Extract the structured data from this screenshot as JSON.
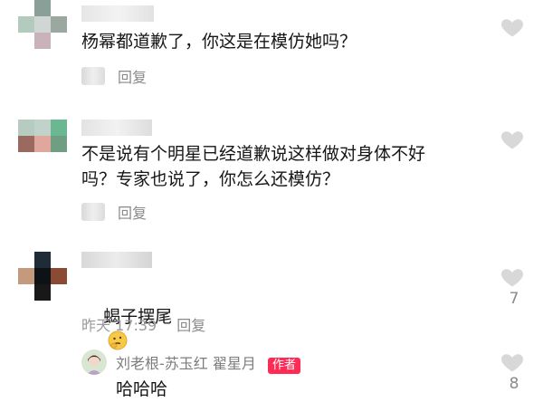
{
  "comments": [
    {
      "text": "杨幂都道歉了，你这是在模仿她吗？",
      "reply_label": "回复"
    },
    {
      "text": "不是说有个明星已经道歉说这样做对身体不好\n吗？专家也说了，你怎么还模仿？",
      "reply_label": "回复"
    },
    {
      "text": "蝎子摆尾",
      "time": "昨天 17:39",
      "reply_label": "回复",
      "likes": "7"
    }
  ],
  "reply": {
    "name": "刘老根-苏玉红 翟星月",
    "badge": "作者",
    "text": "哈哈哈",
    "likes": "8"
  },
  "colors": {
    "badge": "#fe2c55",
    "meta": "#9a9a9a",
    "heart": "#d8d8d8"
  },
  "icons": [
    "heart-icon",
    "thinking-emoji-icon"
  ]
}
